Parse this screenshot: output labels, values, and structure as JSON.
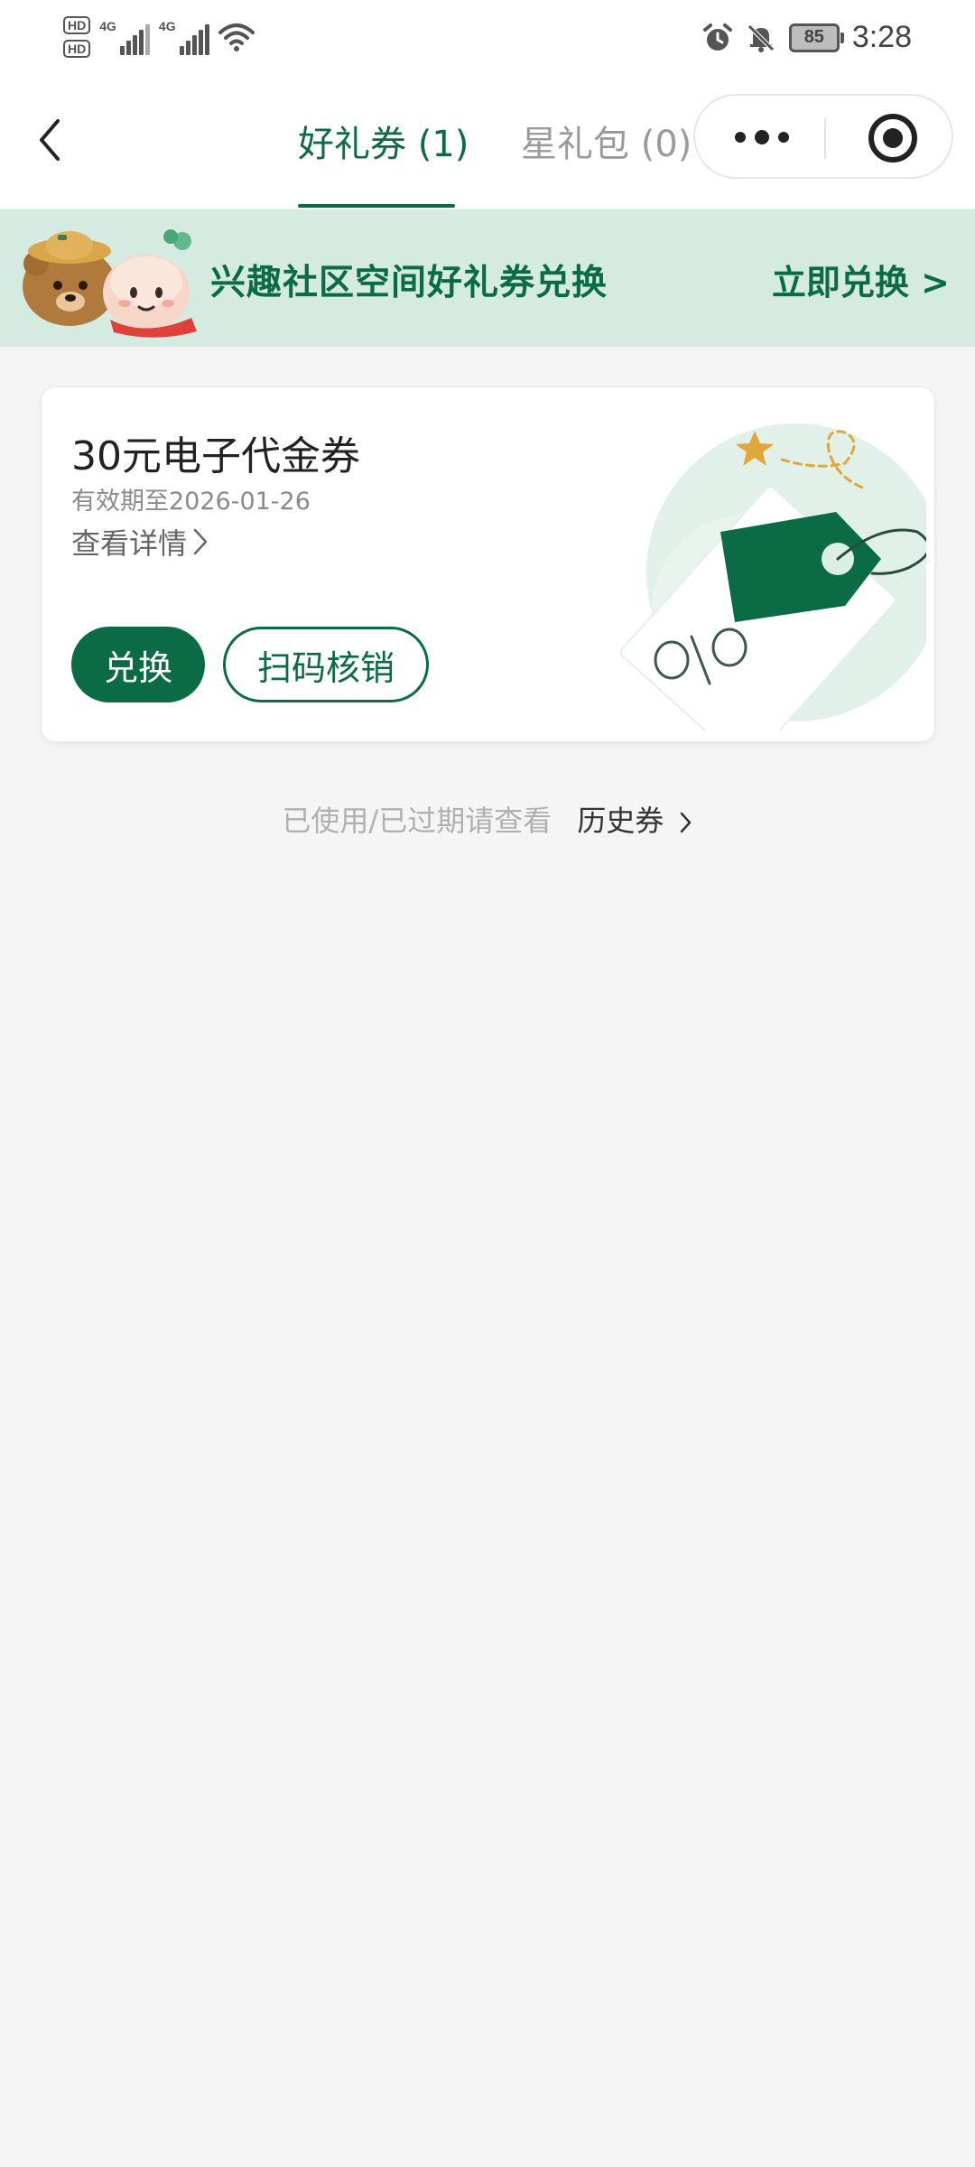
{
  "status_bar": {
    "sim1_badge": "HD",
    "sim2_badge": "HD",
    "network1": "4G",
    "network2": "4G",
    "battery": "85",
    "time": "3:28",
    "icons": [
      "alarm-icon",
      "bell-muted-icon",
      "wifi-icon"
    ]
  },
  "nav": {
    "tabs": [
      {
        "label": "好礼券 (1)",
        "active": true
      },
      {
        "label": "星礼包 (0)",
        "active": false
      }
    ],
    "capsule_icons": [
      "more-dots-icon",
      "close-target-icon"
    ]
  },
  "banner": {
    "title": "兴趣社区空间好礼券兑换",
    "action": "立即兑换 >"
  },
  "coupon": {
    "name": "30元电子代金券",
    "expiry": "有效期至2026-01-26",
    "detail_link": "查看详情",
    "redeem_button": "兑换",
    "scan_button": "扫码核销"
  },
  "history": {
    "hint": "已使用/已过期请查看",
    "link": "历史券"
  },
  "colors": {
    "brand_green": "#0b6b45",
    "banner_bg": "#d5ebe2",
    "page_bg": "#f5f5f5"
  }
}
